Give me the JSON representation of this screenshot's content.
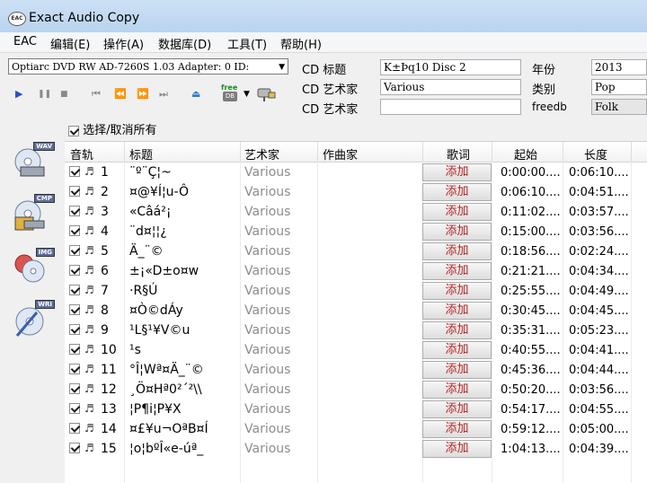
{
  "window": {
    "title": "Exact Audio Copy",
    "icon": "EAC"
  },
  "menu": [
    "EAC",
    "编辑(E)",
    "操作(A)",
    "数据库(D)",
    "工具(T)",
    "帮助(H)"
  ],
  "drive": {
    "selected": "Optiarc DVD RW AD-7260S 1.03  Adapter: 0  ID:",
    "arrow": "▼"
  },
  "cd": {
    "title_label": "CD 标题",
    "title_value": "K±Þq10 Disc 2",
    "artist_label": "CD 艺术家",
    "artist_value": "Various",
    "composer_label": "CD 艺术家",
    "composer_value": "",
    "year_label": "年份",
    "year_value": "2013",
    "genre_label": "类别",
    "genre_value": "Pop",
    "freedb_label": "freedb",
    "freedb_value": "Folk"
  },
  "toolbar": {
    "play": "▶",
    "pause": "❚❚",
    "stop": "■",
    "prev": "⏮",
    "rew": "⏪",
    "ffw": "⏩",
    "next": "⏭",
    "eject": "⏏",
    "free_label": "free",
    "db_label": "DB",
    "dropdown": "▼"
  },
  "select_all": "选择/取消所有",
  "sidebar": [
    "WAV",
    "CMP",
    "IMG",
    "WRI"
  ],
  "columns": [
    "音轨",
    "标题",
    "艺术家",
    "作曲家",
    "歌词",
    "起始",
    "长度"
  ],
  "add_label": "添加",
  "note_glyph": "♬",
  "tracks": [
    {
      "num": "1",
      "title": "¨º¨Ç¦~",
      "artist": "Various",
      "start": "0:00:00....",
      "length": "0:06:10...."
    },
    {
      "num": "2",
      "title": "¤@¥Í¦u-Ô",
      "artist": "Various",
      "start": "0:06:10....",
      "length": "0:04:51...."
    },
    {
      "num": "3",
      "title": "«Câá²¡",
      "artist": "Various",
      "start": "0:11:02....",
      "length": "0:03:57...."
    },
    {
      "num": "4",
      "title": "¨d¤¦¦¿",
      "artist": "Various",
      "start": "0:15:00....",
      "length": "0:03:56...."
    },
    {
      "num": "5",
      "title": "Ä_¨©",
      "artist": "Various",
      "start": "0:18:56....",
      "length": "0:02:24...."
    },
    {
      "num": "6",
      "title": "±¡«D±o¤w",
      "artist": "Various",
      "start": "0:21:21....",
      "length": "0:04:34...."
    },
    {
      "num": "7",
      "title": "·R§Ú",
      "artist": "Various",
      "start": "0:25:55....",
      "length": "0:04:49...."
    },
    {
      "num": "8",
      "title": "¤Ò©dÁy",
      "artist": "Various",
      "start": "0:30:45....",
      "length": "0:04:45...."
    },
    {
      "num": "9",
      "title": "¹L§¹¥V©u",
      "artist": "Various",
      "start": "0:35:31....",
      "length": "0:05:23...."
    },
    {
      "num": "10",
      "title": "¹s",
      "artist": "Various",
      "start": "0:40:55....",
      "length": "0:04:41...."
    },
    {
      "num": "11",
      "title": "°Î¦Wª¤Ä_¨©",
      "artist": "Various",
      "start": "0:45:36....",
      "length": "0:04:44...."
    },
    {
      "num": "12",
      "title": "¸Ö¤Hª0²´²\\\\",
      "artist": "Various",
      "start": "0:50:20....",
      "length": "0:03:56...."
    },
    {
      "num": "13",
      "title": "¦P¶i¦P¥X",
      "artist": "Various",
      "start": "0:54:17....",
      "length": "0:04:55...."
    },
    {
      "num": "14",
      "title": "¤£¥u¬OªB¤Í",
      "artist": "Various",
      "start": "0:59:12....",
      "length": "0:05:00...."
    },
    {
      "num": "15",
      "title": "¦o¦bºÎ«e-úª_",
      "artist": "Various",
      "start": "1:04:13....",
      "length": "0:04:39...."
    }
  ]
}
